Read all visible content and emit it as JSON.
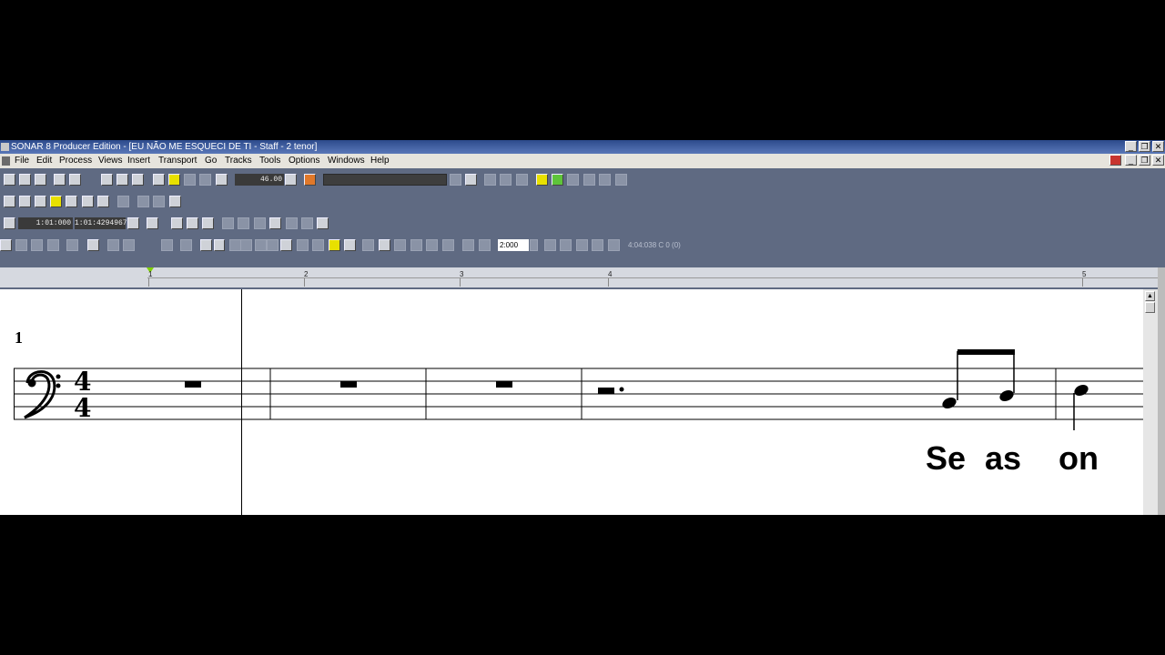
{
  "window": {
    "title": "SONAR 8 Producer Edition - [EU NÃO ME ESQUECI DE TI - Staff - 2 tenor]"
  },
  "menu": [
    "File",
    "Edit",
    "Process",
    "Views",
    "Insert",
    "Transport",
    "Go",
    "Tracks",
    "Tools",
    "Options",
    "Windows",
    "Help"
  ],
  "toolbar": {
    "tempo": "46.00",
    "time_display": "1:01:000",
    "position_display": "1:01:42949672",
    "snap_value": "2:000",
    "cursor_readout": "4:04:038  C 0 (0)"
  },
  "ruler": {
    "measures": [
      "1",
      "2",
      "3",
      "4",
      "5"
    ]
  },
  "staff": {
    "measure_number": "1",
    "clef": "bass-clef",
    "time_signature": "4/4",
    "time_sig_top": "4",
    "time_sig_bottom": "4"
  },
  "lyrics": [
    "Se",
    "as",
    "on"
  ],
  "colors": {
    "background": "#000000",
    "workspace": "#5f6a82",
    "titlebar": "#2c4a8c",
    "menubar": "#e6e4dd",
    "ruler": "#d6d9e0",
    "playhead_marker": "#7cd000"
  }
}
